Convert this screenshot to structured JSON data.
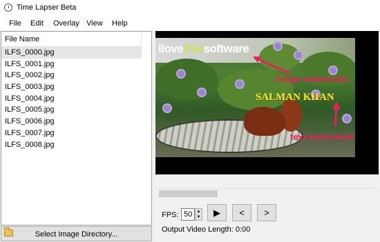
{
  "window": {
    "title": "Time Lapser Beta"
  },
  "menu": [
    "File",
    "Edit",
    "Overlay",
    "View",
    "Help"
  ],
  "file_list": {
    "header": "File Name",
    "files": [
      "ILFS_0000.jpg",
      "ILFS_0001.jpg",
      "ILFS_0002.jpg",
      "ILFS_0003.jpg",
      "ILFS_0004.jpg",
      "ILFS_0005.jpg",
      "ILFS_0006.jpg",
      "ILFS_0007.jpg",
      "ILFS_0008.jpg"
    ],
    "selected_index": 0
  },
  "select_dir_button": {
    "label": "Select Image Directory...",
    "icon": "folder-open-icon"
  },
  "preview": {
    "image_watermark": {
      "part1": "ilove",
      "part2": "free",
      "part3": "software"
    },
    "text_watermark": "SALMAN KHAN",
    "annotations": {
      "image": "image watermark",
      "text": "text watermark"
    },
    "annotation_color": "#e5215a"
  },
  "controls": {
    "fps_label": "FPS:",
    "fps_value": "50",
    "play_label": "▶",
    "prev_label": "<",
    "next_label": ">",
    "output_length": "Output Video Length: 0:00"
  }
}
